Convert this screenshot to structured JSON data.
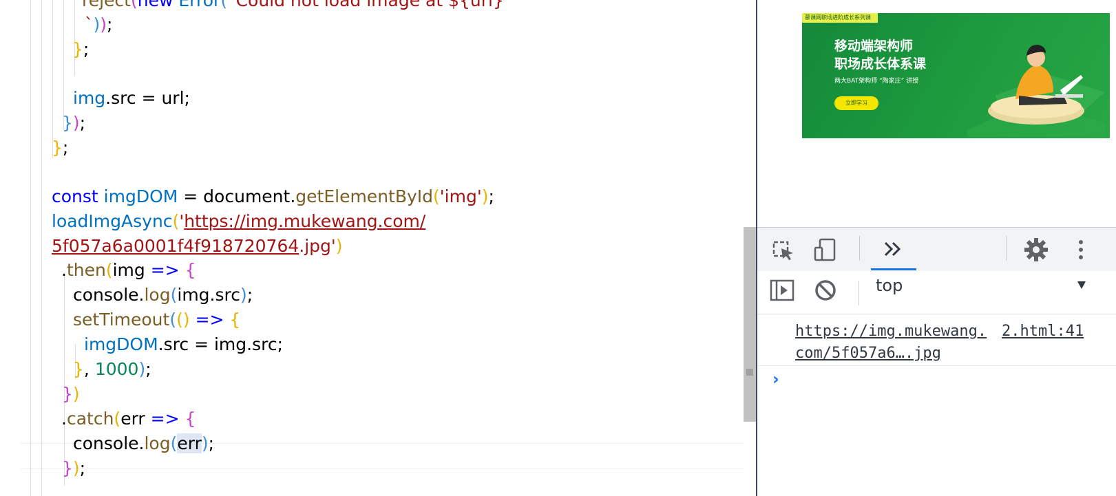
{
  "editor": {
    "lines": [
      {
        "tokens": [
          {
            "t": "reject",
            "c": "fn"
          },
          {
            "t": "(",
            "c": "br2"
          },
          {
            "t": "new ",
            "c": "kw"
          },
          {
            "t": "Error",
            "c": "var"
          },
          {
            "t": "(",
            "c": "br3"
          },
          {
            "t": "`Could not load image at ${url}",
            "c": "str"
          }
        ]
      },
      {
        "tokens": [
          {
            "t": "`",
            "c": "str"
          },
          {
            "t": ")",
            "c": "br3"
          },
          {
            "t": ")",
            "c": "br2"
          },
          {
            "t": ";",
            "c": "plain"
          }
        ]
      },
      {
        "tokens": [
          {
            "t": "}",
            "c": "br1"
          },
          {
            "t": ";",
            "c": "plain"
          }
        ]
      },
      {
        "tokens": []
      },
      {
        "tokens": [
          {
            "t": "img",
            "c": "var"
          },
          {
            "t": ".src = url;",
            "c": "plain"
          }
        ]
      },
      {
        "tokens": [
          {
            "t": "}",
            "c": "br3"
          },
          {
            "t": ")",
            "c": "br2"
          },
          {
            "t": ";",
            "c": "plain"
          }
        ]
      },
      {
        "tokens": [
          {
            "t": "}",
            "c": "br1"
          },
          {
            "t": ";",
            "c": "plain"
          }
        ]
      },
      {
        "tokens": []
      },
      {
        "tokens": [
          {
            "t": "const ",
            "c": "kw"
          },
          {
            "t": "imgDOM",
            "c": "var"
          },
          {
            "t": " = document.",
            "c": "plain"
          },
          {
            "t": "getElementById",
            "c": "fn"
          },
          {
            "t": "(",
            "c": "br1"
          },
          {
            "t": "'img'",
            "c": "str"
          },
          {
            "t": ")",
            "c": "br1"
          },
          {
            "t": ";",
            "c": "plain"
          }
        ]
      },
      {
        "tokens": [
          {
            "t": "loadImgAsync",
            "c": "var"
          },
          {
            "t": "(",
            "c": "br1"
          },
          {
            "t": "'",
            "c": "str"
          },
          {
            "t": "https://img.mukewang.com/",
            "c": "link"
          }
        ]
      },
      {
        "tokens": [
          {
            "t": "5f057a6a0001f4f918720764",
            "c": "link"
          },
          {
            "t": ".jpg'",
            "c": "str"
          },
          {
            "t": ")",
            "c": "br1"
          }
        ]
      },
      {
        "tokens": [
          {
            "t": ".",
            "c": "plain"
          },
          {
            "t": "then",
            "c": "fn"
          },
          {
            "t": "(",
            "c": "br1"
          },
          {
            "t": "img",
            "c": "plain"
          },
          {
            "t": " => ",
            "c": "kw"
          },
          {
            "t": "{",
            "c": "br2"
          }
        ]
      },
      {
        "tokens": [
          {
            "t": "console.",
            "c": "plain"
          },
          {
            "t": "log",
            "c": "fn"
          },
          {
            "t": "(",
            "c": "br3"
          },
          {
            "t": "img.src",
            "c": "plain"
          },
          {
            "t": ")",
            "c": "br3"
          },
          {
            "t": ";",
            "c": "plain"
          }
        ]
      },
      {
        "tokens": [
          {
            "t": "setTimeout",
            "c": "fn"
          },
          {
            "t": "(",
            "c": "br3"
          },
          {
            "t": "()",
            "c": "br1"
          },
          {
            "t": " => ",
            "c": "kw"
          },
          {
            "t": "{",
            "c": "br1"
          }
        ]
      },
      {
        "tokens": [
          {
            "t": "imgDOM",
            "c": "var"
          },
          {
            "t": ".src = img.src;",
            "c": "plain"
          }
        ]
      },
      {
        "tokens": [
          {
            "t": "}",
            "c": "br1"
          },
          {
            "t": ", ",
            "c": "plain"
          },
          {
            "t": "1000",
            "c": "num"
          },
          {
            "t": ")",
            "c": "br3"
          },
          {
            "t": ";",
            "c": "plain"
          }
        ]
      },
      {
        "tokens": [
          {
            "t": "}",
            "c": "br2"
          },
          {
            "t": ")",
            "c": "br1"
          }
        ]
      },
      {
        "tokens": [
          {
            "t": ".",
            "c": "plain"
          },
          {
            "t": "catch",
            "c": "fn"
          },
          {
            "t": "(",
            "c": "br1"
          },
          {
            "t": "err",
            "c": "plain"
          },
          {
            "t": " => ",
            "c": "kw"
          },
          {
            "t": "{",
            "c": "br2"
          }
        ]
      },
      {
        "tokens": [
          {
            "t": "console.",
            "c": "plain"
          },
          {
            "t": "log",
            "c": "fn"
          },
          {
            "t": "(",
            "c": "br3"
          },
          {
            "t": "err",
            "c": "sel"
          },
          {
            "t": ")",
            "c": "br3"
          },
          {
            "t": ";",
            "c": "plain"
          }
        ]
      },
      {
        "tokens": [
          {
            "t": "}",
            "c": "br2"
          },
          {
            "t": ")",
            "c": "br1"
          },
          {
            "t": ";",
            "c": "plain"
          }
        ]
      }
    ]
  },
  "banner": {
    "tag": "慕课网职场进阶成长系列课",
    "title_line1": "移动端架构师",
    "title_line2": "职场成长体系课",
    "subtitle": "两大BAT架构师 “陶家庄” 讲授",
    "button": "立即学习"
  },
  "devtools": {
    "context": "top",
    "log_message": "https://img.mukewang.com/5f057a6….jpg",
    "log_source": "2.html:41",
    "prompt": "›"
  },
  "colors": {
    "accent": "#1a73e8",
    "banner_green": "#1e9b3e",
    "banner_yellow": "#f5e600"
  }
}
